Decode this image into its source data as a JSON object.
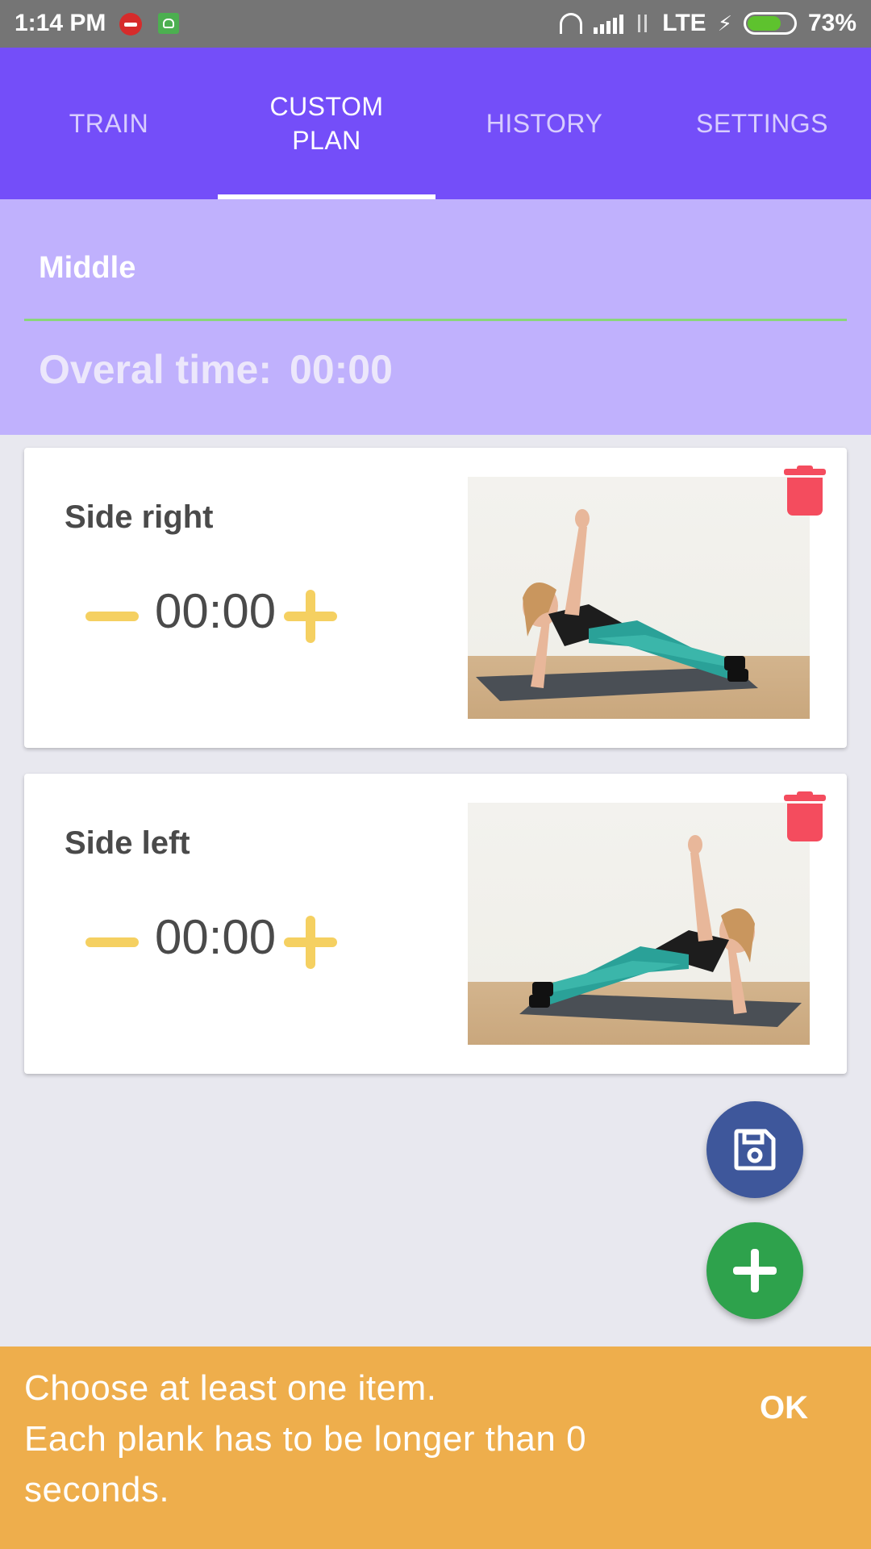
{
  "status_bar": {
    "time": "1:14 PM",
    "network": "LTE",
    "battery": "73%",
    "battery_level": 0.73
  },
  "tabs": [
    {
      "label": "TRAIN",
      "active": false
    },
    {
      "label": "CUSTOM\nPLAN",
      "active": true
    },
    {
      "label": "HISTORY",
      "active": false
    },
    {
      "label": "SETTINGS",
      "active": false
    }
  ],
  "plan": {
    "name": "Middle",
    "overall_label": "Overal time:",
    "overall_value": "00:00"
  },
  "exercises": [
    {
      "name": "Side right",
      "time": "00:00",
      "image": "side-plank-right-photo"
    },
    {
      "name": "Side left",
      "time": "00:00",
      "image": "side-plank-left-photo"
    }
  ],
  "snackbar": {
    "message": "Choose at least one item.\nEach plank has to be longer than 0\nseconds.",
    "action": "OK"
  },
  "colors": {
    "primary": "#744ef9",
    "header_panel": "#c0b1fd",
    "accent_yellow": "#f5d061",
    "delete_red": "#f44c5e",
    "save_fab": "#3e579b",
    "add_fab": "#2ea24c",
    "snackbar": "#eeae4c"
  }
}
